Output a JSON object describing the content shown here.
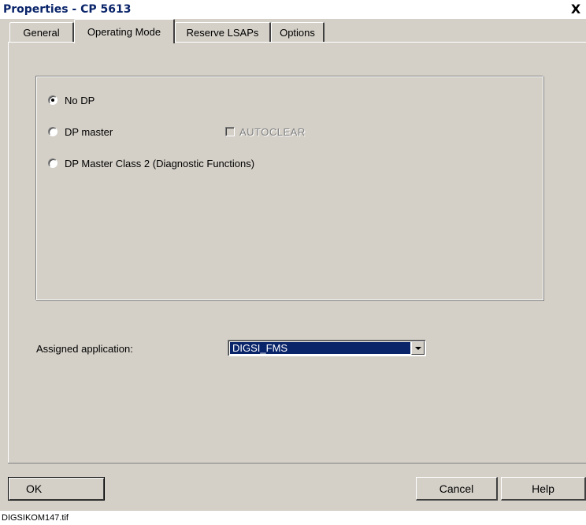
{
  "window": {
    "title": "Properties - CP 5613",
    "close_glyph": "X"
  },
  "tabs": [
    {
      "label": "General",
      "active": false
    },
    {
      "label": "Operating Mode",
      "active": true
    },
    {
      "label": "Reserve LSAPs",
      "active": false
    },
    {
      "label": "Options",
      "active": false
    }
  ],
  "operating_mode": {
    "options": [
      {
        "label": "No DP",
        "checked": true
      },
      {
        "label": "DP master",
        "checked": false
      },
      {
        "label": "DP Master Class 2 (Diagnostic Functions)",
        "checked": false
      }
    ],
    "autoclear": {
      "label": "AUTOCLEAR",
      "checked": false,
      "enabled": false
    }
  },
  "assigned_application": {
    "label": "Assigned application:",
    "value": "DIGSI_FMS"
  },
  "buttons": {
    "ok": "OK",
    "cancel": "Cancel",
    "help": "Help"
  },
  "caption": "DIGSIKOM147.tif",
  "colors": {
    "title_text": "#0a246a",
    "dialog_face": "#d4d0c8",
    "selection": "#0a246a"
  }
}
